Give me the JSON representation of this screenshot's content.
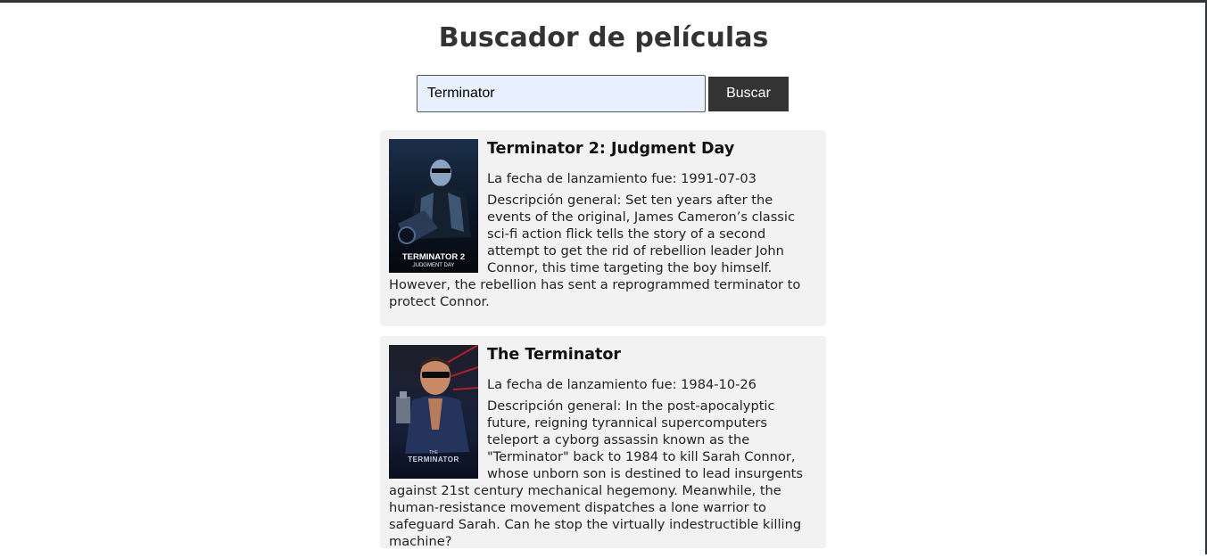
{
  "page": {
    "title": "Buscador de películas"
  },
  "search": {
    "value": "Terminator",
    "button_label": "Buscar"
  },
  "results": [
    {
      "title": "Terminator 2: Judgment Day",
      "release_label": "La fecha de lanzamiento fue: 1991-07-03",
      "overview_label": "Descripción general: Set ten years after the events of the original, James Cameron’s classic sci-fi action flick tells the story of a second attempt to get the rid of rebellion leader John Connor, this time targeting the boy himself. However, the rebellion has sent a reprogrammed terminator to protect Connor.",
      "poster_text": [
        "TERMINATOR 2",
        "JUDGMENT DAY"
      ]
    },
    {
      "title": "The Terminator",
      "release_label": "La fecha de lanzamiento fue: 1984-10-26",
      "overview_label": "Descripción general: In the post-apocalyptic future, reigning tyrannical supercomputers teleport a cyborg assassin known as the \"Terminator\" back to 1984 to kill Sarah Connor, whose unborn son is destined to lead insurgents against 21st century mechanical hegemony. Meanwhile, the human-resistance movement dispatches a lone warrior to safeguard Sarah. Can he stop the virtually indestructible killing machine?",
      "poster_text": [
        "THE",
        "TERMINATOR"
      ]
    }
  ]
}
